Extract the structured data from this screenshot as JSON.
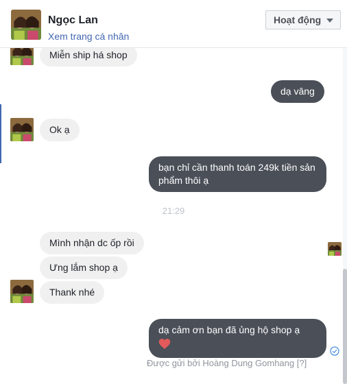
{
  "header": {
    "name": "Ngọc Lan",
    "profile_link": "Xem trang cá nhân",
    "status_button": "Hoạt động"
  },
  "messages": [
    {
      "side": "in",
      "text": "Miễn ship há shop"
    },
    {
      "side": "out",
      "text": "dạ vâng"
    },
    {
      "side": "in",
      "text": "Ok ạ"
    },
    {
      "side": "out",
      "text": "bạn chỉ cần thanh toán 249k tiền sản phẩm thôi ạ"
    },
    {
      "side": "in",
      "text": "Mình nhận dc ốp rồi"
    },
    {
      "side": "in",
      "text": "Ưng lắm shop ạ"
    },
    {
      "side": "in",
      "text": "Thank nhé"
    },
    {
      "side": "out",
      "text": "dạ cảm ơn bạn đã ủng hộ shop ạ"
    }
  ],
  "timestamp": "21:29",
  "sent_by": "Được gửi bởi Hoàng Dung Gomhang [?]",
  "colors": {
    "link": "#4267b2",
    "outgoing_bubble": "#4a4f58",
    "incoming_bubble": "#f1f0f0"
  },
  "icons": {
    "status_caret": "caret-down-icon",
    "heart": "heart-icon",
    "sent": "check-circle-icon"
  }
}
